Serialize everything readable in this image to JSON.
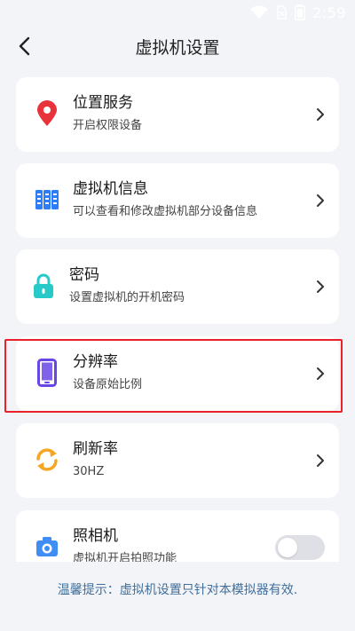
{
  "status_bar": {
    "time": "2:59"
  },
  "header": {
    "title": "虚拟机设置"
  },
  "items": [
    {
      "name": "位置服务",
      "desc": "开启权限设备",
      "icon": "location-pin-icon"
    },
    {
      "name": "虚拟机信息",
      "desc": "可以查看和修改虚拟机部分设备信息",
      "icon": "server-icon"
    },
    {
      "name": "密码",
      "desc": "设置虚拟机的开机密码",
      "icon": "lock-icon"
    },
    {
      "name": "分辨率",
      "desc": "设备原始比例",
      "icon": "phone-icon"
    },
    {
      "name": "刷新率",
      "desc": "30HZ",
      "icon": "refresh-icon"
    },
    {
      "name": "照相机",
      "desc": "虚拟机开启拍照功能",
      "icon": "camera-icon",
      "toggle_on": false
    }
  ],
  "tip": "温馨提示：虚拟机设置只针对本模拟器有效.",
  "colors": {
    "background": "#f3f4f8",
    "highlight": "#e8212a",
    "tip": "#3f6f9c",
    "location": "#e8333a",
    "server": "#2f7df6",
    "lock": "#27c9c9",
    "phone": "#6a45e6",
    "refresh": "#f5a623",
    "camera": "#3f8ef5"
  }
}
